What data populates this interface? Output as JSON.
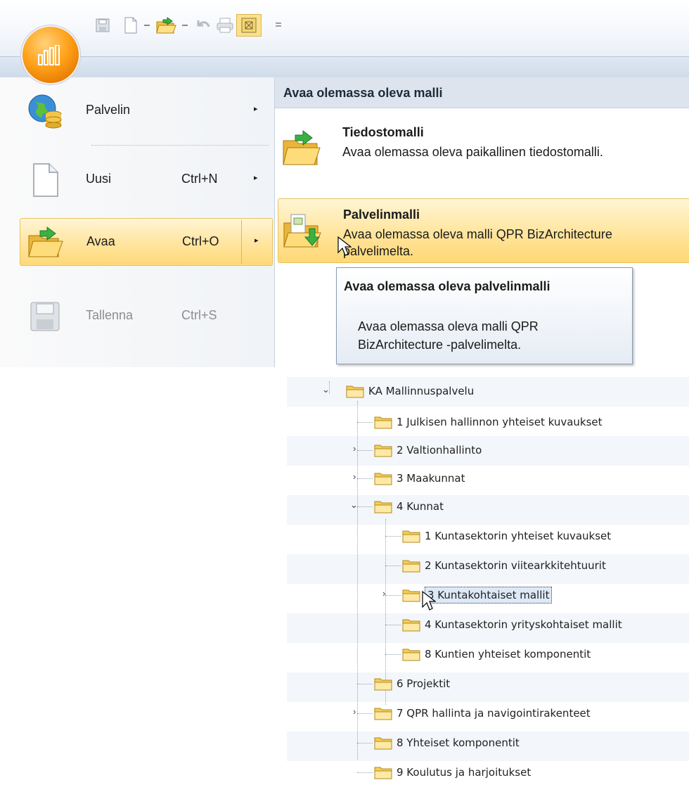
{
  "app": {
    "accent": "#ffa21b",
    "highlight": "#ffe6a2"
  },
  "quick_access": {
    "overflow_glyph": "="
  },
  "menu": {
    "left_items": [
      {
        "label": "Palvelin",
        "shortcut": "",
        "has_submenu": true,
        "icon": "server-globe-icon"
      },
      {
        "label": "Uusi",
        "shortcut": "Ctrl+N",
        "has_submenu": true,
        "icon": "new-document-icon"
      },
      {
        "label": "Avaa",
        "shortcut": "Ctrl+O",
        "has_submenu": true,
        "icon": "open-folder-icon",
        "selected": true
      },
      {
        "label": "Tallenna",
        "shortcut": "Ctrl+S",
        "has_submenu": false,
        "icon": "save-icon",
        "disabled": true
      }
    ],
    "submenu_arrow": "▸",
    "right_header": "Avaa olemassa oleva malli",
    "right_options": [
      {
        "title": "Tiedostomalli",
        "description": "Avaa olemassa oleva paikallinen tiedostomalli.",
        "icon": "open-folder-icon"
      },
      {
        "title": "Palvelinmalli",
        "description": "Avaa olemassa oleva malli QPR BizArchitecture",
        "description_line2": "palvelimelta.",
        "icon": "server-model-icon",
        "highlighted": true
      }
    ]
  },
  "tooltip": {
    "title": "Avaa olemassa oleva palvelinmalli",
    "body": "Avaa olemassa oleva malli QPR BizArchitecture -palvelimelta."
  },
  "tree": {
    "toggle_expanded": "⌄",
    "toggle_collapsed": "›",
    "root": "KA Mallinnuspalvelu",
    "items": [
      {
        "label": "1 Julkisen hallinnon yhteiset kuvaukset",
        "level": 1,
        "toggle": ""
      },
      {
        "label": "2 Valtionhallinto",
        "level": 1,
        "toggle": "collapsed"
      },
      {
        "label": "3 Maakunnat",
        "level": 1,
        "toggle": "collapsed"
      },
      {
        "label": "4 Kunnat",
        "level": 1,
        "toggle": "expanded"
      },
      {
        "label": "1 Kuntasektorin yhteiset kuvaukset",
        "level": 2,
        "toggle": ""
      },
      {
        "label": "2 Kuntasektorin viitearkkitehtuurit",
        "level": 2,
        "toggle": ""
      },
      {
        "label": "3 Kuntakohtaiset mallit",
        "level": 2,
        "toggle": "collapsed",
        "selected": true
      },
      {
        "label": "4 Kuntasektorin yrityskohtaiset mallit",
        "level": 2,
        "toggle": ""
      },
      {
        "label": "8 Kuntien yhteiset komponentit",
        "level": 2,
        "toggle": ""
      },
      {
        "label": "6 Projektit",
        "level": 1,
        "toggle": ""
      },
      {
        "label": "7 QPR hallinta ja navigointirakenteet",
        "level": 1,
        "toggle": "collapsed"
      },
      {
        "label": "8 Yhteiset komponentit",
        "level": 1,
        "toggle": ""
      },
      {
        "label": "9 Koulutus ja harjoitukset",
        "level": 1,
        "toggle": ""
      }
    ]
  }
}
